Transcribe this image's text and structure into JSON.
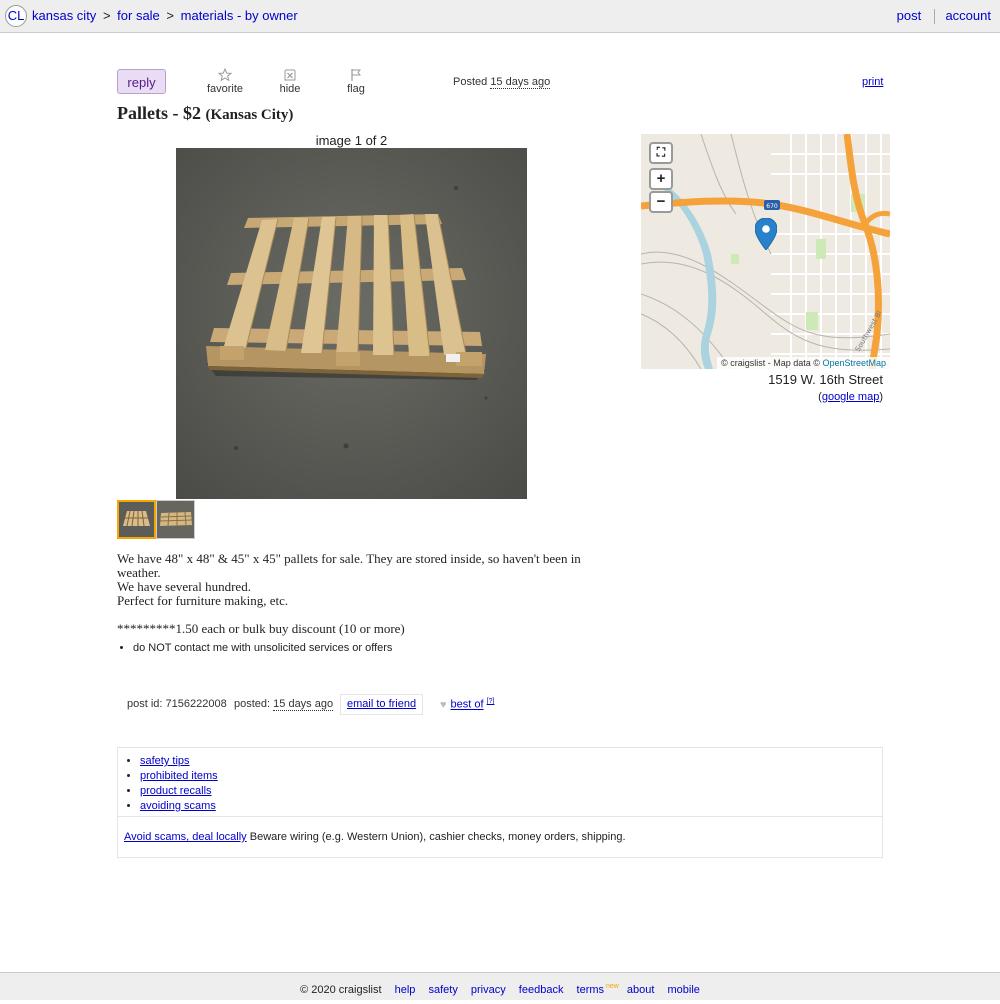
{
  "header": {
    "logo": "CL",
    "breadcrumbs": [
      "kansas city",
      "for sale",
      "materials - by owner"
    ],
    "separator": ">",
    "links": {
      "post": "post",
      "account": "account"
    }
  },
  "actions": {
    "reply": "reply",
    "favorite": "favorite",
    "hide": "hide",
    "flag": "flag",
    "posted_label": "Posted",
    "posted_ago": "15 days ago",
    "print": "print"
  },
  "listing": {
    "title": "Pallets - $2",
    "location": "(Kansas City)",
    "image_counter": "image 1 of 2",
    "body": {
      "line1": "We have 48\" x 48\" & 45\" x 45\" pallets for sale. They are stored inside, so haven't been in weather.",
      "line2": "We have several hundred.",
      "line3": "Perfect for furniture making, etc.",
      "line4": "*********1.50 each or bulk buy discount (10 or more)"
    },
    "notices": [
      "do NOT contact me with unsolicited services or offers"
    ]
  },
  "map": {
    "zoom_in": "+",
    "zoom_out": "−",
    "attribution": "© craigslist - Map data ©",
    "osm": "OpenStreetMap",
    "shield": "670",
    "street_label": "Southwest Bl",
    "address": "1519 W. 16th Street",
    "google_map": "google map"
  },
  "postinfo": {
    "post_id": "post id: 7156222008",
    "posted_label": "posted:",
    "posted_ago": "15 days ago",
    "email_friend": "email to friend",
    "best_of": "best of",
    "best_of_help": "[?]"
  },
  "safety": {
    "links": [
      "safety tips",
      "prohibited items",
      "product recalls",
      "avoiding scams"
    ],
    "avoid_link": "Avoid scams, deal locally",
    "avoid_text": " Beware wiring (e.g. Western Union), cashier checks, money orders, shipping."
  },
  "footer": {
    "copyright": "© 2020 craigslist",
    "links": [
      "help",
      "safety",
      "privacy",
      "feedback",
      "terms",
      "about",
      "mobile"
    ],
    "terms_badge": "new"
  },
  "colors": {
    "link": "#0000cc",
    "reply_bg": "#eadcf4",
    "highway": "#f5a23a",
    "river": "#aad3df",
    "pin": "#2a81cb"
  }
}
